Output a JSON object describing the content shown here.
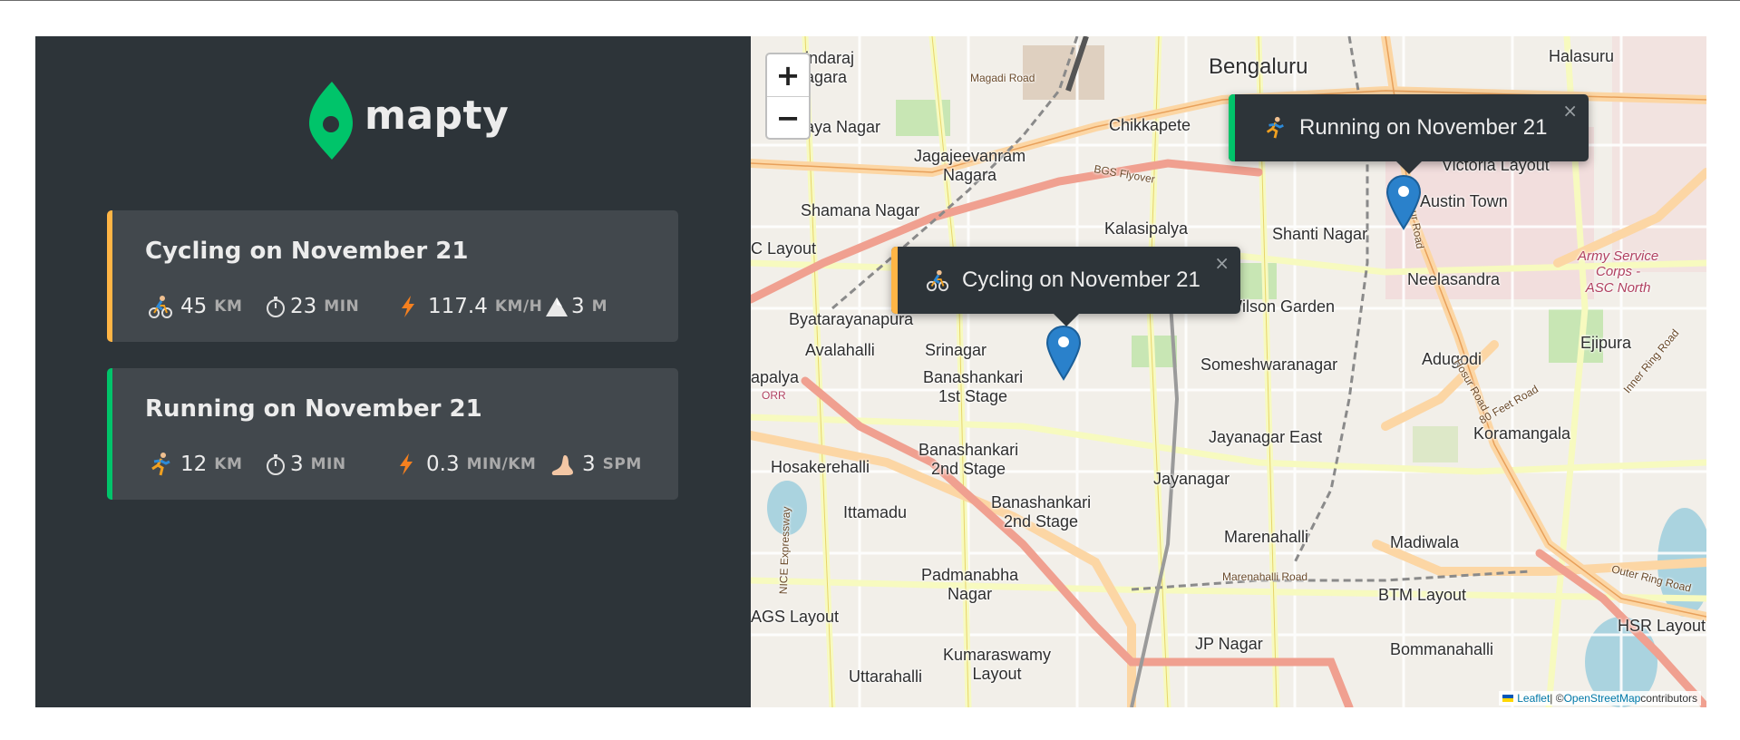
{
  "app": {
    "logo_text": "mapty",
    "logo_color": "#00c46a"
  },
  "workouts": [
    {
      "type": "cycling",
      "title": "Cycling on November 21",
      "accent": "#ffb545",
      "icon": "cyclist-icon",
      "details": [
        {
          "icon": "cyclist-icon",
          "value": "45",
          "unit": "km"
        },
        {
          "icon": "stopwatch-icon",
          "value": "23",
          "unit": "min"
        },
        {
          "icon": "lightning-icon",
          "value": "117.4",
          "unit": "km/h"
        },
        {
          "icon": "mountain-icon",
          "value": "3",
          "unit": "m"
        }
      ]
    },
    {
      "type": "running",
      "title": "Running on November 21",
      "accent": "#00c46a",
      "icon": "runner-icon",
      "details": [
        {
          "icon": "runner-icon",
          "value": "12",
          "unit": "km"
        },
        {
          "icon": "stopwatch-icon",
          "value": "3",
          "unit": "min"
        },
        {
          "icon": "lightning-icon",
          "value": "0.3",
          "unit": "min/km"
        },
        {
          "icon": "foot-icon",
          "value": "3",
          "unit": "spm"
        }
      ]
    }
  ],
  "map": {
    "zoom_in_label": "+",
    "zoom_out_label": "−",
    "popups": [
      {
        "text": "Running on November 21",
        "close": "×"
      },
      {
        "text": "Cycling on November 21",
        "close": "×"
      }
    ],
    "labels": {
      "bengaluru": "Bengaluru",
      "halasuru": "Halasuru",
      "chikkapete": "Chikkapete",
      "jagajeevanram": "Jagajeevanram\nNagara",
      "shamana": "Shamana Nagar",
      "kalasipalya": "Kalasipalya",
      "shanti": "Shanti Nagar",
      "austin": "Austin Town",
      "victoria": "Victoria Layout",
      "neelasandra": "Neelasandra",
      "wilson": "Wilson Garden",
      "ejipura": "Ejipura",
      "byatarayanapura": "Byatarayanapura",
      "avalahalli": "Avalahalli",
      "srinagar": "Srinagar",
      "banashankari1": "Banashankari\n1st Stage",
      "someshwara": "Someshwaranagar",
      "adugodi": "Adugodi",
      "koramangala": "Koramangala",
      "hosakerehalli": "Hosakerehalli",
      "banashankari2a": "Banashankari\n2nd Stage",
      "jayanagar_east": "Jayanagar East",
      "jayanagar": "Jayanagar",
      "ittamadu": "Ittamadu",
      "banashankari2b": "Banashankari\n2nd Stage",
      "madiwala": "Madiwala",
      "marenahalli": "Marenahalli",
      "padmanabha": "Padmanabha\nNagar",
      "btm": "BTM Layout",
      "ags": "AGS Layout",
      "jp": "JP Nagar",
      "hsr": "HSR Layout",
      "bommanahalli": "Bommanahalli",
      "uttarahalli": "Uttarahalli",
      "kumaraswamy": "Kumaraswamy\nLayout",
      "ayanagar": "aya Nagar",
      "indaraj": "indaraj\nagara",
      "clayout": "C Layout",
      "apalya": "apalya",
      "army": "Army Service\nCorps -\nASC North",
      "magadi_road": "Magadi Road",
      "bgs": "BGS Flyover",
      "hosur_road": "Hosur Road",
      "outer_ring": "Outer Ring Road",
      "inner_ring": "Inner Ring Road",
      "marenahalli_road": "Marenahalli Road",
      "nice": "NICE Expressway",
      "orr": "ORR",
      "eighty_feet": "80 Feet Road"
    },
    "attribution": {
      "leaflet": "Leaflet",
      "sep": " | © ",
      "osm": "OpenStreetMap",
      "contrib": " contributors"
    }
  }
}
